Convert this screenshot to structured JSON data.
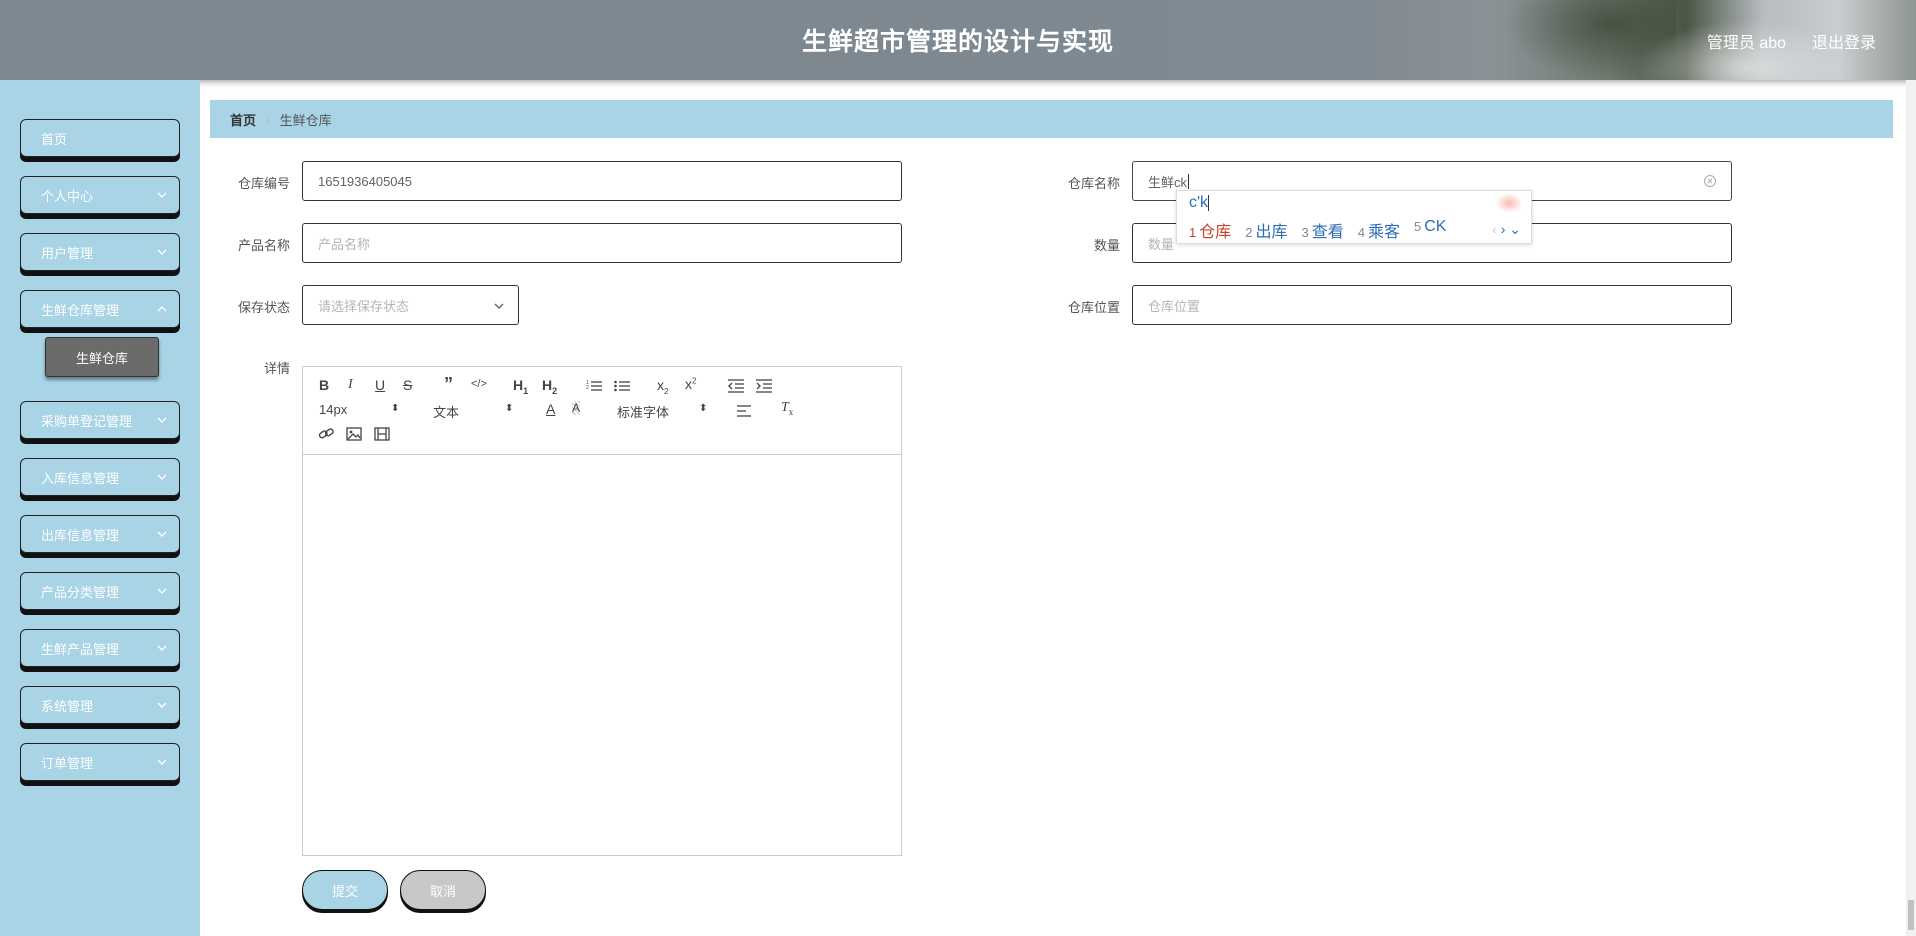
{
  "header": {
    "title": "生鲜超市管理的设计与实现",
    "user": "管理员 abo",
    "logout": "退出登录"
  },
  "sidebar": {
    "items": [
      {
        "label": "首页"
      },
      {
        "label": "个人中心"
      },
      {
        "label": "用户管理"
      },
      {
        "label": "生鲜仓库管理"
      },
      {
        "label": "采购单登记管理"
      },
      {
        "label": "入库信息管理"
      },
      {
        "label": "出库信息管理"
      },
      {
        "label": "产品分类管理"
      },
      {
        "label": "生鲜产品管理"
      },
      {
        "label": "系统管理"
      },
      {
        "label": "订单管理"
      }
    ],
    "submenu": {
      "label": "生鲜仓库"
    }
  },
  "breadcrumb": {
    "home": "首页",
    "separator": "/",
    "current": "生鲜仓库"
  },
  "form": {
    "warehouse_no": {
      "label": "仓库编号",
      "value": "1651936405045"
    },
    "warehouse_name": {
      "label": "仓库名称",
      "value": "生鲜ck"
    },
    "product_name": {
      "label": "产品名称",
      "placeholder": "产品名称"
    },
    "quantity": {
      "label": "数量",
      "placeholder": "数量"
    },
    "storage_status": {
      "label": "保存状态",
      "placeholder": "请选择保存状态"
    },
    "location": {
      "label": "仓库位置",
      "placeholder": "仓库位置"
    },
    "details": {
      "label": "详情"
    }
  },
  "ime": {
    "composition": "c'k",
    "candidates": [
      {
        "num": "1",
        "text": "仓库"
      },
      {
        "num": "2",
        "text": "出库"
      },
      {
        "num": "3",
        "text": "查看"
      },
      {
        "num": "4",
        "text": "乘客"
      },
      {
        "num": "5",
        "text": "CK"
      }
    ]
  },
  "editor": {
    "font_size": "14px",
    "block_type": "文本",
    "font_family": "标准字体"
  },
  "buttons": {
    "submit": "提交",
    "cancel": "取消"
  },
  "colors": {
    "accent": "#a8d4e6",
    "cancel": "#c8c8c8",
    "submenu_bg": "#6b6b6b"
  }
}
